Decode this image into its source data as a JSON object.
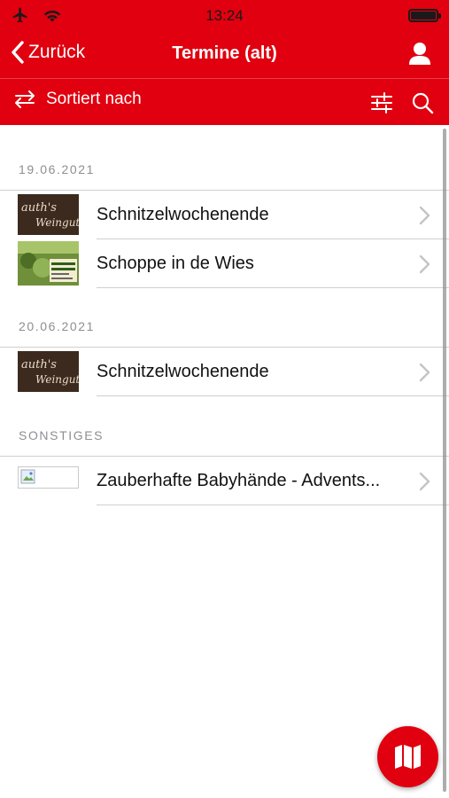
{
  "status_bar": {
    "time": "13:24"
  },
  "nav": {
    "back_label": "Zurück",
    "title": "Termine (alt)"
  },
  "toolbar": {
    "sort_label": "Sortiert nach"
  },
  "sections": [
    {
      "header": "19.06.2021",
      "items": [
        {
          "title": "Schnitzelwochenende",
          "thumb": "weingut-logo"
        },
        {
          "title": "Schoppe in de Wies",
          "thumb": "event-poster"
        }
      ]
    },
    {
      "header": "20.06.2021",
      "items": [
        {
          "title": "Schnitzelwochenende",
          "thumb": "weingut-logo"
        }
      ]
    },
    {
      "header": "SONSTIGES",
      "items": [
        {
          "title": "Zauberhafte Babyhände - Advents...",
          "thumb": "broken-image"
        }
      ]
    }
  ],
  "colors": {
    "accent": "#e0000f",
    "separator": "#cfcfd3",
    "section_header": "#8e8e93"
  }
}
